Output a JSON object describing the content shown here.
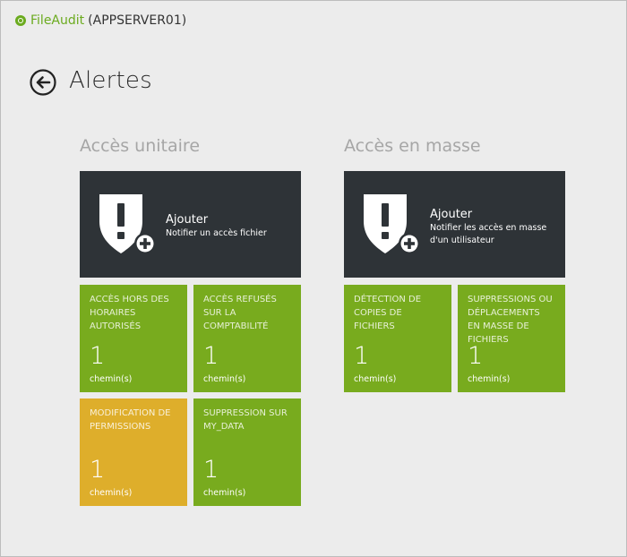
{
  "app": {
    "brand": "FileAudit",
    "server": "(APPSERVER01)"
  },
  "page": {
    "title": "Alertes"
  },
  "sections": [
    {
      "title": "Accès unitaire",
      "add_tile": {
        "title": "Ajouter",
        "subtitle_lines": [
          "Notifier un accès fichier"
        ]
      },
      "tiles": [
        {
          "label_lines": [
            "ACCÈS HORS DES",
            "HORAIRES",
            "AUTORISÉS"
          ],
          "value": "1",
          "unit": "chemin(s)",
          "color": "#78ab1e"
        },
        {
          "label_lines": [
            "ACCÈS REFUSÉS",
            "SUR LA",
            "COMPTABILITÉ"
          ],
          "value": "1",
          "unit": "chemin(s)",
          "color": "#78ab1e"
        },
        {
          "label_lines": [
            "MODIFICATION DE",
            "PERMISSIONS"
          ],
          "value": "1",
          "unit": "chemin(s)",
          "color": "#deae2b"
        },
        {
          "label_lines": [
            "SUPPRESSION SUR",
            "MY_DATA"
          ],
          "value": "1",
          "unit": "chemin(s)",
          "color": "#78ab1e"
        }
      ]
    },
    {
      "title": "Accès en masse",
      "add_tile": {
        "title": "Ajouter",
        "subtitle_lines": [
          "Notifier les accès en masse",
          "d'un utilisateur"
        ]
      },
      "tiles": [
        {
          "label_lines": [
            "DÉTECTION DE",
            "COPIES DE",
            "FICHIERS"
          ],
          "value": "1",
          "unit": "chemin(s)",
          "color": "#78ab1e"
        },
        {
          "label_lines": [
            "SUPPRESSIONS OU",
            "DÉPLACEMENTS",
            "EN MASSE DE",
            "FICHIERS"
          ],
          "value": "1",
          "unit": "chemin(s)",
          "color": "#78ab1e"
        }
      ]
    }
  ],
  "colors": {
    "accent_green": "#78ab1e",
    "accent_amber": "#deae2b",
    "tile_dark": "#2e3337",
    "brand_green": "#6bab1f"
  },
  "icons": {
    "back": "back-arrow-circle-icon",
    "add_alert": "shield-exclamation-plus-icon",
    "logo": "fileaudit-logo-icon"
  }
}
